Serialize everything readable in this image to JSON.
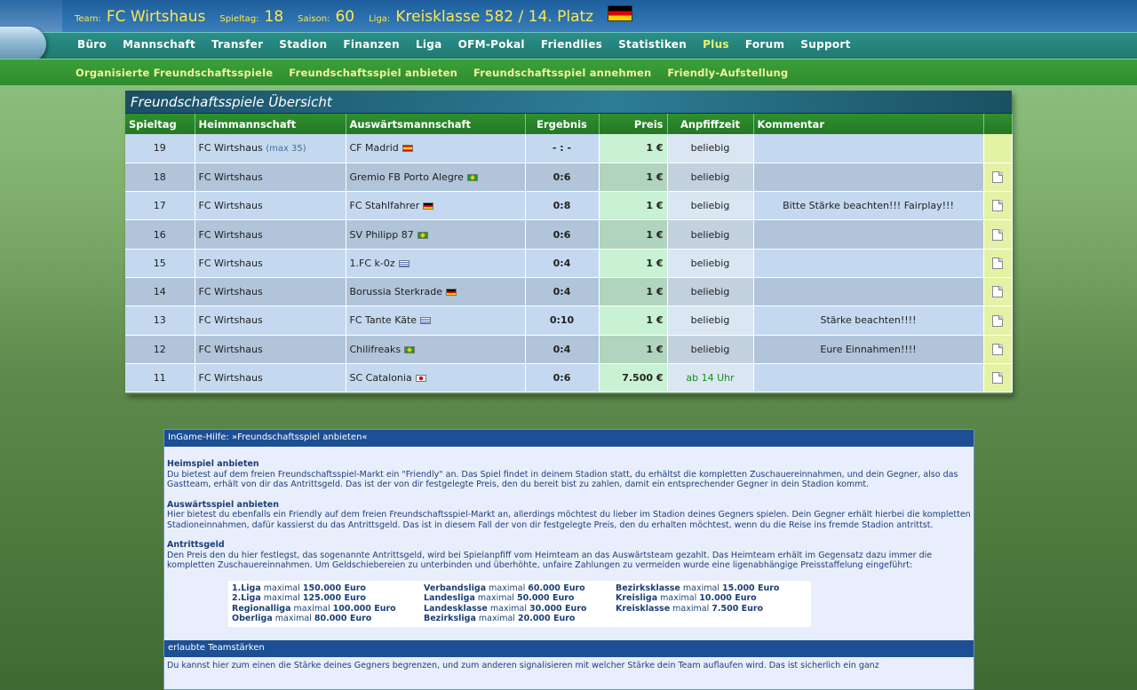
{
  "header": {
    "team_label": "Team:",
    "team_name": "FC Wirtshaus",
    "spieltag_label": "Spieltag:",
    "spieltag_value": "18",
    "saison_label": "Saison:",
    "saison_value": "60",
    "liga_label": "Liga:",
    "liga_value": "Kreisklasse 582 / 14. Platz"
  },
  "main_nav": [
    "Büro",
    "Mannschaft",
    "Transfer",
    "Stadion",
    "Finanzen",
    "Liga",
    "OFM-Pokal",
    "Friendlies",
    "Statistiken",
    "Plus",
    "Forum",
    "Support"
  ],
  "sub_nav": [
    "Organisierte Freundschaftsspiele",
    "Freundschaftsspiel anbieten",
    "Freundschaftsspiel annehmen",
    "Friendly-Aufstellung"
  ],
  "overview": {
    "title": "Freundschaftsspiele Übersicht",
    "columns": [
      "Spieltag",
      "Heimmannschaft",
      "Auswärtsmannschaft",
      "Ergebnis",
      "Preis",
      "Anpfiffzeit",
      "Kommentar"
    ],
    "rows": [
      {
        "spieltag": "19",
        "home": "FC Wirtshaus",
        "home_extra": "(max 35)",
        "away": "CF Madrid",
        "flag": "es",
        "result": "- : -",
        "price": "1 €",
        "kickoff": "beliebig",
        "comment": "",
        "doc": false
      },
      {
        "spieltag": "18",
        "home": "FC Wirtshaus",
        "home_extra": "",
        "away": "Gremio FB Porto Alegre",
        "flag": "br",
        "result": "0:6",
        "price": "1 €",
        "kickoff": "beliebig",
        "comment": "",
        "doc": true
      },
      {
        "spieltag": "17",
        "home": "FC Wirtshaus",
        "home_extra": "",
        "away": "FC Stahlfahrer",
        "flag": "de",
        "result": "0:8",
        "price": "1 €",
        "kickoff": "beliebig",
        "comment": "Bitte Stärke beachten!!! Fairplay!!!",
        "doc": true
      },
      {
        "spieltag": "16",
        "home": "FC Wirtshaus",
        "home_extra": "",
        "away": "SV Philipp 87",
        "flag": "br",
        "result": "0:6",
        "price": "1 €",
        "kickoff": "beliebig",
        "comment": "",
        "doc": true
      },
      {
        "spieltag": "15",
        "home": "FC Wirtshaus",
        "home_extra": "",
        "away": "1.FC k-0z",
        "flag": "us",
        "result": "0:4",
        "price": "1 €",
        "kickoff": "beliebig",
        "comment": "",
        "doc": true
      },
      {
        "spieltag": "14",
        "home": "FC Wirtshaus",
        "home_extra": "",
        "away": "Borussia Sterkrade",
        "flag": "de",
        "result": "0:4",
        "price": "1 €",
        "kickoff": "beliebig",
        "comment": "",
        "doc": true
      },
      {
        "spieltag": "13",
        "home": "FC Wirtshaus",
        "home_extra": "",
        "away": "FC Tante Käte",
        "flag": "us",
        "result": "0:10",
        "price": "1 €",
        "kickoff": "beliebig",
        "comment": "Stärke beachten!!!!",
        "doc": true
      },
      {
        "spieltag": "12",
        "home": "FC Wirtshaus",
        "home_extra": "",
        "away": "Chilifreaks",
        "flag": "br",
        "result": "0:4",
        "price": "1 €",
        "kickoff": "beliebig",
        "comment": "Eure Einnahmen!!!!",
        "doc": true
      },
      {
        "spieltag": "11",
        "home": "FC Wirtshaus",
        "home_extra": "",
        "away": "SC Catalonia",
        "flag": "jp",
        "result": "0:6",
        "price": "7.500 €",
        "kickoff": "ab 14 Uhr",
        "comment": "",
        "doc": true
      }
    ]
  },
  "help": {
    "title": "InGame-Hilfe: »Freundschaftsspiel anbieten«",
    "sections": [
      {
        "heading": "Heimspiel anbieten",
        "text": "Du bietest auf dem freien Freundschaftsspiel-Markt ein \"Friendly\" an. Das Spiel findet in deinem Stadion statt, du erhältst die kompletten Zuschauereinnahmen, und dein Gegner, also das Gastteam, erhält von dir das Antrittsgeld. Das ist der von dir festgelegte Preis, den du bereit bist zu zahlen, damit ein entsprechender Gegner in dein Stadion kommt."
      },
      {
        "heading": "Auswärtsspiel anbieten",
        "text": "Hier bietest du ebenfalls ein Friendly auf dem freien Freundschaftsspiel-Markt an, allerdings möchtest du lieber im Stadion deines Gegners spielen. Dein Gegner erhält hierbei die kompletten Stadioneinnahmen, dafür kassierst du das Antrittsgeld. Das ist in diesem Fall der von dir festgelegte Preis, den du erhalten möchtest, wenn du die Reise ins fremde Stadion antrittst."
      },
      {
        "heading": "Antrittsgeld",
        "text": "Den Preis den du hier festlegst, das sogenannte Antrittsgeld, wird bei Spielanpfiff vom Heimteam an das Auswärtsteam gezahlt. Das Heimteam erhält im Gegensatz dazu immer die kompletten Zuschauereinnahmen. Um Geldschiebereien zu unterbinden und überhöhte, unfaire Zahlungen zu vermeiden wurde eine ligenabhängige Preisstaffelung eingeführt:"
      }
    ],
    "limits": [
      [
        {
          "league": "1.Liga",
          "word": "maximal",
          "amount": "150.000 Euro"
        },
        {
          "league": "2.Liga",
          "word": "maximal",
          "amount": "125.000 Euro"
        },
        {
          "league": "Regionalliga",
          "word": "maximal",
          "amount": "100.000 Euro"
        },
        {
          "league": "Oberliga",
          "word": "maximal",
          "amount": "80.000 Euro"
        }
      ],
      [
        {
          "league": "Verbandsliga",
          "word": "maximal",
          "amount": "60.000 Euro"
        },
        {
          "league": "Landesliga",
          "word": "maximal",
          "amount": "50.000 Euro"
        },
        {
          "league": "Landesklasse",
          "word": "maximal",
          "amount": "30.000 Euro"
        },
        {
          "league": "Bezirksliga",
          "word": "maximal",
          "amount": "20.000 Euro"
        }
      ],
      [
        {
          "league": "Bezirksklasse",
          "word": "maximal",
          "amount": "15.000 Euro"
        },
        {
          "league": "Kreisliga",
          "word": "maximal",
          "amount": "10.000 Euro"
        },
        {
          "league": "Kreisklasse",
          "word": "maximal",
          "amount": "7.500 Euro"
        }
      ]
    ],
    "section2_title": "erlaubte Teamstärken",
    "section2_text": "Du kannst hier zum einen die Stärke deines Gegners begrenzen, und zum anderen signalisieren mit welcher Stärke dein Team auflaufen wird. Das ist sicherlich ein ganz"
  }
}
